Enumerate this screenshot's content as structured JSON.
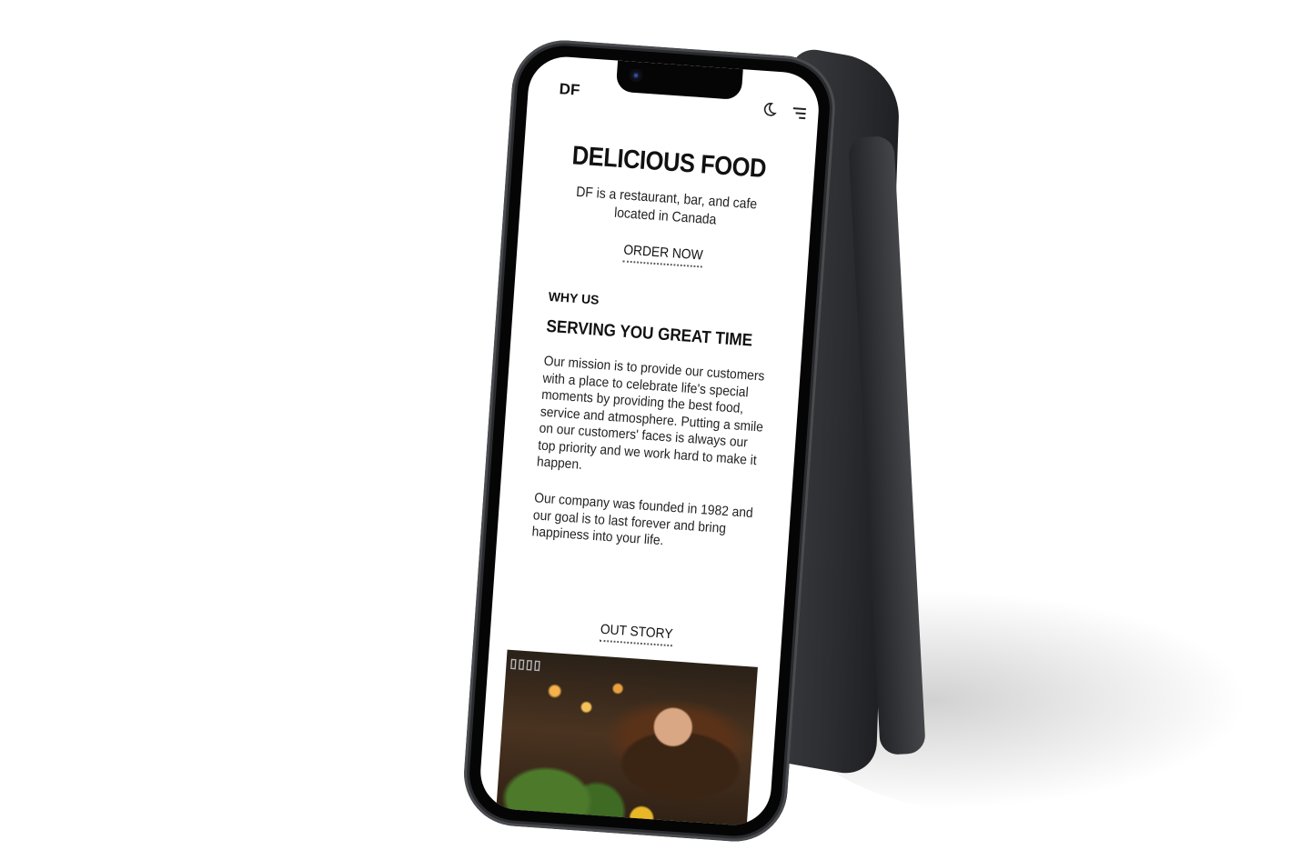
{
  "app": {
    "logo": "DF",
    "icons": [
      "moon-icon",
      "menu-icon"
    ]
  },
  "hero": {
    "title": "DELICIOUS FOOD",
    "subtitle": "DF is a restaurant, bar, and cafe located in Canada",
    "cta_label": "ORDER NOW"
  },
  "about": {
    "eyebrow": "WHY US",
    "heading": "SERVING YOU GREAT TIME",
    "paragraph1": "Our mission is to provide our customers with a place to celebrate life's special moments by providing the best food, service and atmosphere. Putting a smile on our customers' faces is always our top priority and we work hard to make it happen.",
    "paragraph2": "Our company was founded in 1982 and our goal is to last forever and bring happiness into your life.",
    "story_link": "OUT STORY"
  },
  "colors": {
    "phone_frame": "#2a2b2e",
    "text": "#111111",
    "background": "#ffffff"
  }
}
